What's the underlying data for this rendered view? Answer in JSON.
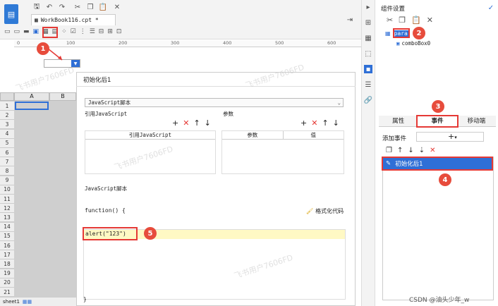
{
  "app": {
    "tab_title": "WorkBook116.cpt *",
    "ruler_marks": [
      "0",
      "100",
      "200",
      "300",
      "400",
      "500",
      "600"
    ]
  },
  "sheet": {
    "col_a": "A",
    "col_b": "B",
    "rows": [
      "1",
      "2",
      "3",
      "4",
      "5",
      "6",
      "7",
      "8",
      "9",
      "10",
      "11",
      "12",
      "13",
      "14",
      "15",
      "16",
      "17",
      "18",
      "19",
      "20",
      "21"
    ],
    "sheet_tab": "sheet1"
  },
  "dialog": {
    "title": "初始化后1",
    "script_select": "JavaScript脚本",
    "ref_js_label": "引用JavaScript",
    "ref_js_col": "引用JavaScript",
    "params_label": "参数",
    "params_col_name": "参数",
    "params_col_value": "值",
    "script_section": "JavaScript脚本",
    "function_text": "function() {",
    "format_label": "格式化代码",
    "code_line": "alert(\"123\")",
    "closing_brace": "}"
  },
  "right_panel": {
    "title": "组件设置",
    "tree_root": "para",
    "tree_child": "comboBox0",
    "tab_attr": "属性",
    "tab_event": "事件",
    "tab_mobile": "移动端",
    "add_event_label": "添加事件",
    "event_item": "初始化后1"
  },
  "badges": [
    "1",
    "2",
    "3",
    "4",
    "5"
  ],
  "watermark": "飞书用户7606FD",
  "footer_credit": "CSDN @油头少年_w",
  "colors": {
    "accent": "#2f6fd6",
    "badge": "#e74c3c",
    "highlight": "#fff9c4"
  }
}
